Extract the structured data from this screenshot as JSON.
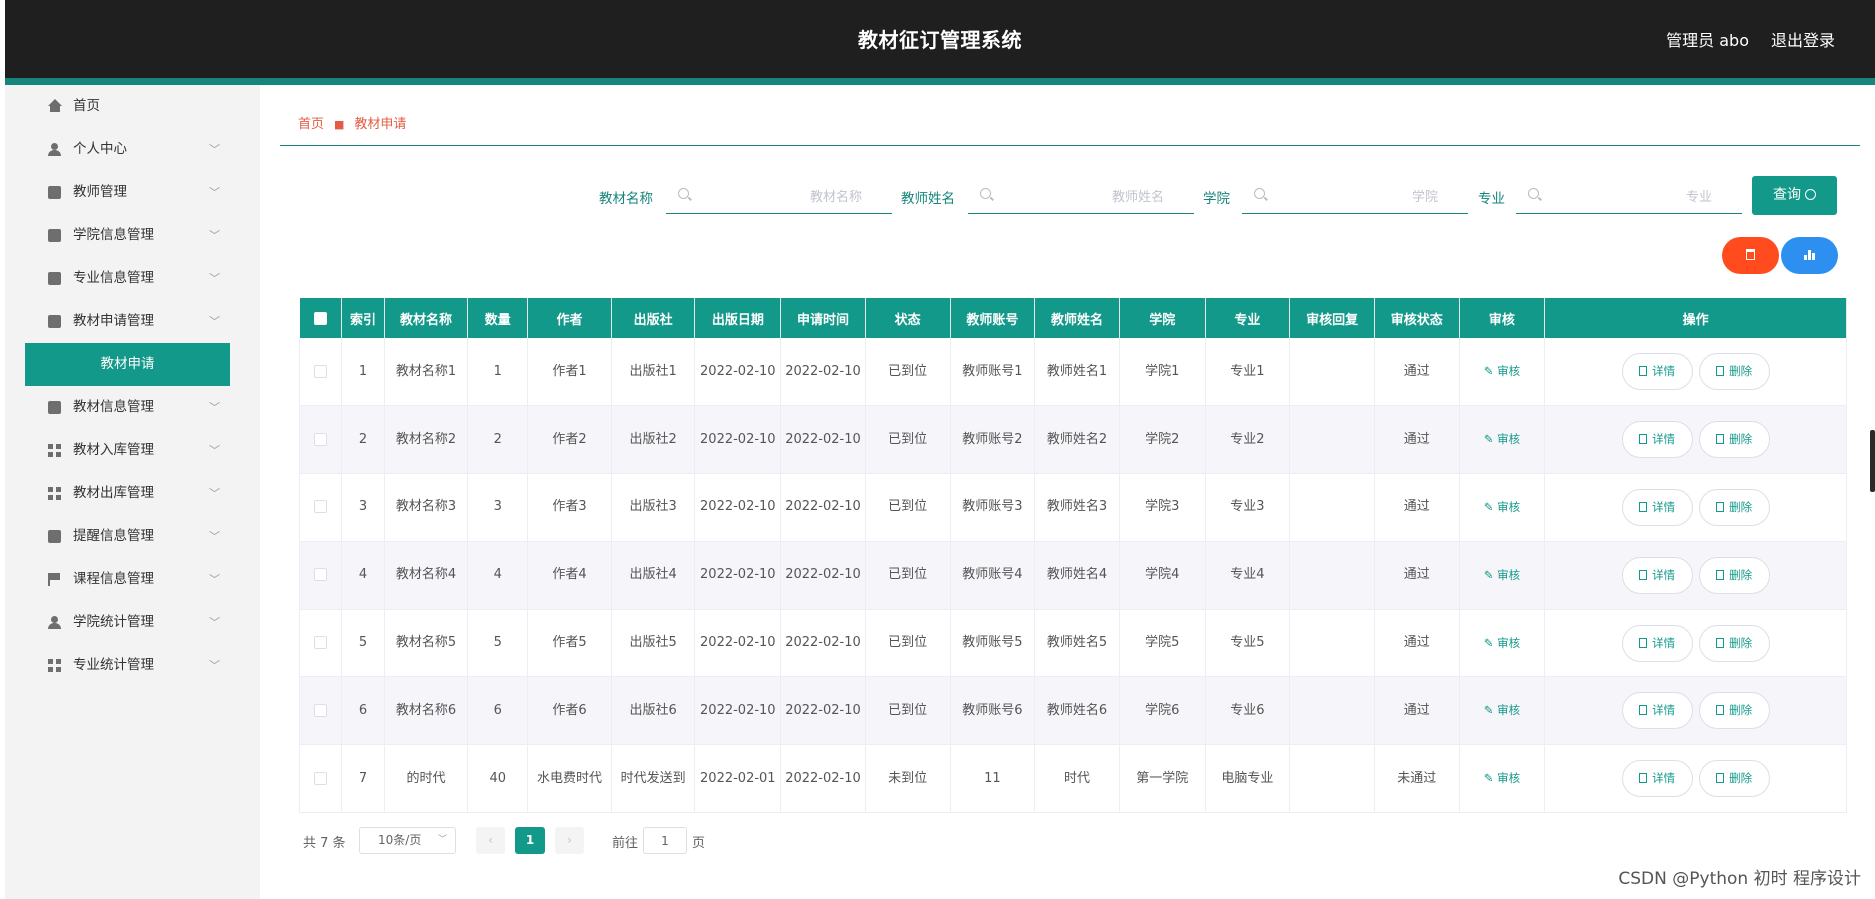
{
  "header": {
    "title": "教材征订管理系统",
    "user": "管理员 abo",
    "logout": "退出登录"
  },
  "sidebar": {
    "items": [
      {
        "label": "首页",
        "icon": "home-icon"
      },
      {
        "label": "个人中心",
        "icon": "person-icon"
      },
      {
        "label": "教师管理",
        "icon": "clipboard-icon"
      },
      {
        "label": "学院信息管理",
        "icon": "chart-icon"
      },
      {
        "label": "专业信息管理",
        "icon": "printer-icon"
      },
      {
        "label": "教材申请管理",
        "icon": "printer-icon"
      },
      {
        "label": "教材申请",
        "icon": ""
      },
      {
        "label": "教材信息管理",
        "icon": "chart-icon"
      },
      {
        "label": "教材入库管理",
        "icon": "grid-icon"
      },
      {
        "label": "教材出库管理",
        "icon": "grid-icon"
      },
      {
        "label": "提醒信息管理",
        "icon": "briefcase-icon"
      },
      {
        "label": "课程信息管理",
        "icon": "flag-icon"
      },
      {
        "label": "学院统计管理",
        "icon": "person-icon"
      },
      {
        "label": "专业统计管理",
        "icon": "grid-icon"
      }
    ]
  },
  "breadcrumb": {
    "home": "首页",
    "current": "教材申请"
  },
  "search": {
    "book_label": "教材名称",
    "book_placeholder": "教材名称",
    "teacher_label": "教师姓名",
    "teacher_placeholder": "教师姓名",
    "college_label": "学院",
    "college_placeholder": "学院",
    "major_label": "专业",
    "major_placeholder": "专业",
    "query_label": "查询"
  },
  "table": {
    "headers": [
      "",
      "索引",
      "教材名称",
      "数量",
      "作者",
      "出版社",
      "出版日期",
      "申请时间",
      "状态",
      "教师账号",
      "教师姓名",
      "学院",
      "专业",
      "审核回复",
      "审核状态",
      "审核",
      "操作"
    ],
    "rows": [
      {
        "idx": "1",
        "name": "教材名称1",
        "qty": "1",
        "author": "作者1",
        "publisher": "出版社1",
        "pub_date": "2022-02-10",
        "apply_time": "2022-02-10",
        "status": "已到位",
        "account": "教师账号1",
        "teacher": "教师姓名1",
        "college": "学院1",
        "major": "专业1",
        "reply": "",
        "audit_status": "通过"
      },
      {
        "idx": "2",
        "name": "教材名称2",
        "qty": "2",
        "author": "作者2",
        "publisher": "出版社2",
        "pub_date": "2022-02-10",
        "apply_time": "2022-02-10",
        "status": "已到位",
        "account": "教师账号2",
        "teacher": "教师姓名2",
        "college": "学院2",
        "major": "专业2",
        "reply": "",
        "audit_status": "通过"
      },
      {
        "idx": "3",
        "name": "教材名称3",
        "qty": "3",
        "author": "作者3",
        "publisher": "出版社3",
        "pub_date": "2022-02-10",
        "apply_time": "2022-02-10",
        "status": "已到位",
        "account": "教师账号3",
        "teacher": "教师姓名3",
        "college": "学院3",
        "major": "专业3",
        "reply": "",
        "audit_status": "通过"
      },
      {
        "idx": "4",
        "name": "教材名称4",
        "qty": "4",
        "author": "作者4",
        "publisher": "出版社4",
        "pub_date": "2022-02-10",
        "apply_time": "2022-02-10",
        "status": "已到位",
        "account": "教师账号4",
        "teacher": "教师姓名4",
        "college": "学院4",
        "major": "专业4",
        "reply": "",
        "audit_status": "通过"
      },
      {
        "idx": "5",
        "name": "教材名称5",
        "qty": "5",
        "author": "作者5",
        "publisher": "出版社5",
        "pub_date": "2022-02-10",
        "apply_time": "2022-02-10",
        "status": "已到位",
        "account": "教师账号5",
        "teacher": "教师姓名5",
        "college": "学院5",
        "major": "专业5",
        "reply": "",
        "audit_status": "通过"
      },
      {
        "idx": "6",
        "name": "教材名称6",
        "qty": "6",
        "author": "作者6",
        "publisher": "出版社6",
        "pub_date": "2022-02-10",
        "apply_time": "2022-02-10",
        "status": "已到位",
        "account": "教师账号6",
        "teacher": "教师姓名6",
        "college": "学院6",
        "major": "专业6",
        "reply": "",
        "audit_status": "通过"
      },
      {
        "idx": "7",
        "name": "的时代",
        "qty": "40",
        "author": "水电费时代",
        "publisher": "时代发送到",
        "pub_date": "2022-02-01",
        "apply_time": "2022-02-10",
        "status": "未到位",
        "account": "11",
        "teacher": "时代",
        "college": "第一学院",
        "major": "电脑专业",
        "reply": "",
        "audit_status": "未通过"
      }
    ],
    "audit_link": "审核",
    "detail_label": "详情",
    "delete_label": "删除"
  },
  "pagination": {
    "total": "共 7 条",
    "page_size": "10条/页",
    "prev": "‹",
    "current": "1",
    "next": "›",
    "goto_label": "前往",
    "goto_value": "1",
    "page_label": "页"
  },
  "watermark": "CSDN @Python 初时 程序设计",
  "colors": {
    "accent": "#13998a",
    "header_bg": "#1f1f1f",
    "danger": "#ff4b1e",
    "primary": "#2d8ff0",
    "breadcrumb": "#e45c43"
  }
}
